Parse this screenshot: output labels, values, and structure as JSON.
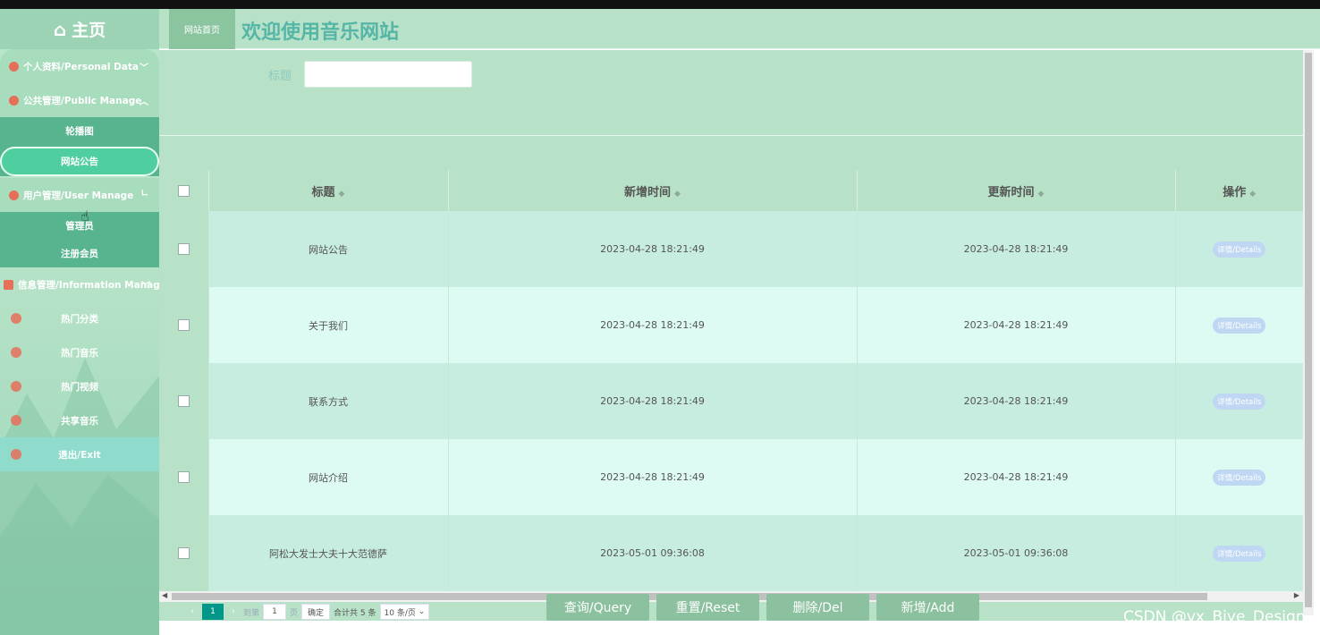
{
  "sidebar": {
    "home_label": "主页",
    "home_icon": "home-icon",
    "menu": {
      "personal_data": "个人资料/Personal Data",
      "public_manage": "公共管理/Public Manage",
      "public_sub": [
        "轮播图",
        "网站公告"
      ],
      "user_manage": "用户管理/User Manage",
      "user_sub": [
        "管理员",
        "注册会员"
      ],
      "information_manage": "信息管理/Information Manage",
      "info_sub": [
        "热门分类",
        "热门音乐",
        "热门视频",
        "共享音乐"
      ],
      "exit": "退出/Exit"
    }
  },
  "header": {
    "tab": "网站首页",
    "title": "欢迎使用音乐网站"
  },
  "search": {
    "label": "标题",
    "value": ""
  },
  "table": {
    "columns": [
      "标题",
      "新增时间",
      "更新时间",
      "操作"
    ],
    "action_label": "详情/Details",
    "rows": [
      {
        "title": "网站公告",
        "created": "2023-04-28 18:21:49",
        "updated": "2023-04-28 18:21:49"
      },
      {
        "title": "关于我们",
        "created": "2023-04-28 18:21:49",
        "updated": "2023-04-28 18:21:49"
      },
      {
        "title": "联系方式",
        "created": "2023-04-28 18:21:49",
        "updated": "2023-04-28 18:21:49"
      },
      {
        "title": "网站介绍",
        "created": "2023-04-28 18:21:49",
        "updated": "2023-04-28 18:21:49"
      },
      {
        "title": "阿松大发士大夫十大范德萨",
        "created": "2023-05-01 09:36:08",
        "updated": "2023-05-01 09:36:08"
      }
    ]
  },
  "pager": {
    "current_page": "1",
    "goto_label": "到第",
    "page_input": "1",
    "page_unit": "页",
    "confirm": "确定",
    "total": "合计共 5 条",
    "page_size": "10 条/页"
  },
  "buttons": {
    "query": "查询/Query",
    "reset": "重置/Reset",
    "delete": "删除/Del",
    "add": "新增/Add"
  },
  "watermark": "CSDN @vx_Biye_Design",
  "colors": {
    "sidebar_bg": "#b5e2c6",
    "sidebar_active_sub": "#57b48f",
    "header_bg": "#b8e2c7",
    "title_color": "#55b5a6",
    "row_odd": "#c7ece0",
    "row_even": "#ddfaf3",
    "button_bg": "#8bc19f",
    "pager_active": "#009688"
  }
}
